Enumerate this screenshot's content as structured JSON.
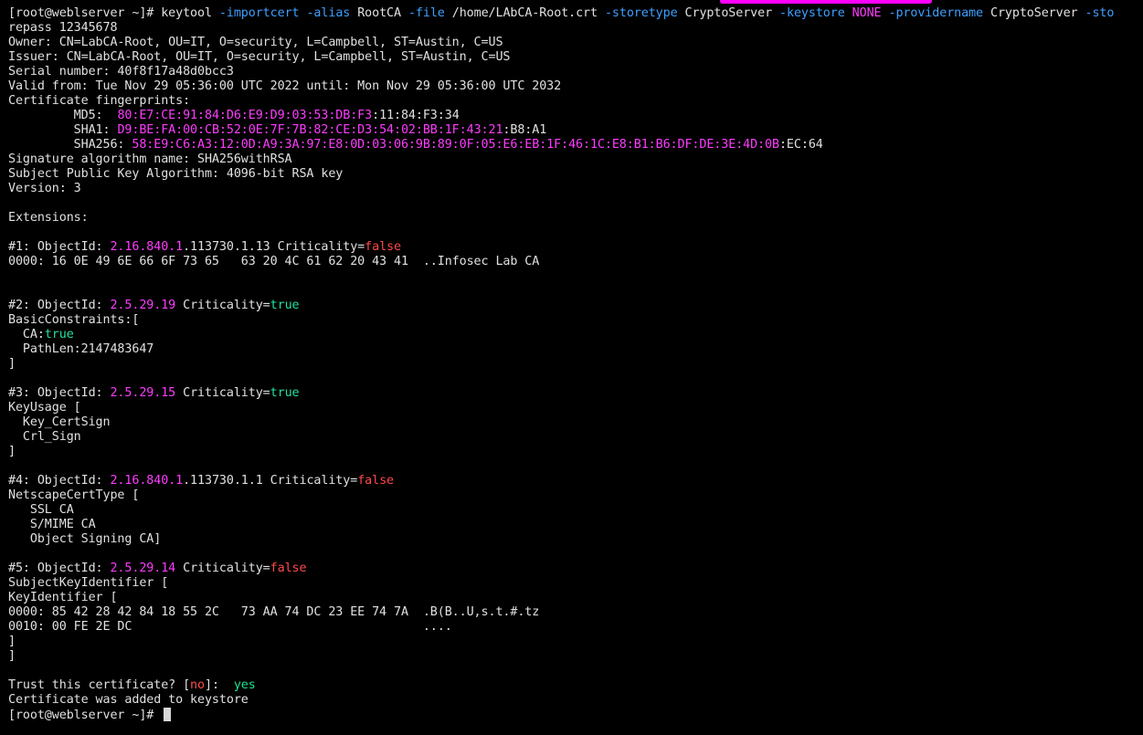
{
  "terminal": {
    "lines": [
      [
        {
          "t": "[root@weblserver ~]# keytool ",
          "c": "default"
        },
        {
          "t": "-importcert",
          "c": "option"
        },
        {
          "t": " ",
          "c": "default"
        },
        {
          "t": "-alias",
          "c": "option"
        },
        {
          "t": " RootCA ",
          "c": "default"
        },
        {
          "t": "-file",
          "c": "option"
        },
        {
          "t": " /home/LAbCA-Root.crt ",
          "c": "default"
        },
        {
          "t": "-storetype",
          "c": "option"
        },
        {
          "t": " CryptoServer ",
          "c": "default"
        },
        {
          "t": "-keystore",
          "c": "option"
        },
        {
          "t": " ",
          "c": "default"
        },
        {
          "t": "NONE",
          "c": "magenta"
        },
        {
          "t": " ",
          "c": "default"
        },
        {
          "t": "-providername",
          "c": "option"
        },
        {
          "t": " CryptoServer ",
          "c": "default"
        },
        {
          "t": "-sto",
          "c": "option"
        }
      ],
      [
        {
          "t": "repass 12345678",
          "c": "default"
        }
      ],
      [
        {
          "t": "Owner: CN=LabCA-Root, OU=IT, O=security, L=Campbell, ST=Austin, C=US",
          "c": "default"
        }
      ],
      [
        {
          "t": "Issuer: CN=LabCA-Root, OU=IT, O=security, L=Campbell, ST=Austin, C=US",
          "c": "default"
        }
      ],
      [
        {
          "t": "Serial number: 40f8f17a48d0bcc3",
          "c": "default"
        }
      ],
      [
        {
          "t": "Valid from: Tue Nov 29 05:36:00 UTC 2022 until: Mon Nov 29 05:36:00 UTC 2032",
          "c": "default"
        }
      ],
      [
        {
          "t": "Certificate fingerprints:",
          "c": "default"
        }
      ],
      [
        {
          "t": "         MD5:  ",
          "c": "default"
        },
        {
          "t": "80:E7:CE:91:84:D6:E9:D9:03:53:DB:F3",
          "c": "magenta"
        },
        {
          "t": ":11:84:F3:34",
          "c": "default"
        }
      ],
      [
        {
          "t": "         SHA1: ",
          "c": "default"
        },
        {
          "t": "D9:BE:FA:00:CB:52:0E:7F:7B:82:CE:D3:54:02:BB:1F:43:21",
          "c": "magenta"
        },
        {
          "t": ":B8:A1",
          "c": "default"
        }
      ],
      [
        {
          "t": "         SHA256: ",
          "c": "default"
        },
        {
          "t": "58:E9:C6:A3:12:0D:A9:3A:97:E8:0D:03:06:9B:89:0F:05:E6:EB:1F:46:1C:E8:B1:B6:DF:DE:3E:4D:0B",
          "c": "magenta"
        },
        {
          "t": ":EC:64",
          "c": "default"
        }
      ],
      [
        {
          "t": "Signature algorithm name: SHA256withRSA",
          "c": "default"
        }
      ],
      [
        {
          "t": "Subject Public Key Algorithm: 4096-bit RSA key",
          "c": "default"
        }
      ],
      [
        {
          "t": "Version: 3",
          "c": "default"
        }
      ],
      [],
      [
        {
          "t": "Extensions:",
          "c": "default"
        }
      ],
      [],
      [
        {
          "t": "#1: ObjectId: ",
          "c": "default"
        },
        {
          "t": "2.16.840.1",
          "c": "magenta"
        },
        {
          "t": ".113730.1.13 Criticality=",
          "c": "default"
        },
        {
          "t": "false",
          "c": "false"
        }
      ],
      [
        {
          "t": "0000: 16 0E 49 6E 66 6F 73 65   63 20 4C 61 62 20 43 41  ..Infosec Lab CA",
          "c": "default"
        }
      ],
      [],
      [],
      [
        {
          "t": "#2: ObjectId: ",
          "c": "default"
        },
        {
          "t": "2.5.29.19",
          "c": "magenta"
        },
        {
          "t": " Criticality=",
          "c": "default"
        },
        {
          "t": "true",
          "c": "true"
        }
      ],
      [
        {
          "t": "BasicConstraints:[",
          "c": "default"
        }
      ],
      [
        {
          "t": "  CA:",
          "c": "default"
        },
        {
          "t": "true",
          "c": "true"
        }
      ],
      [
        {
          "t": "  PathLen:2147483647",
          "c": "default"
        }
      ],
      [
        {
          "t": "]",
          "c": "default"
        }
      ],
      [],
      [
        {
          "t": "#3: ObjectId: ",
          "c": "default"
        },
        {
          "t": "2.5.29.15",
          "c": "magenta"
        },
        {
          "t": " Criticality=",
          "c": "default"
        },
        {
          "t": "true",
          "c": "true"
        }
      ],
      [
        {
          "t": "KeyUsage [",
          "c": "default"
        }
      ],
      [
        {
          "t": "  Key_CertSign",
          "c": "default"
        }
      ],
      [
        {
          "t": "  Crl_Sign",
          "c": "default"
        }
      ],
      [
        {
          "t": "]",
          "c": "default"
        }
      ],
      [],
      [
        {
          "t": "#4: ObjectId: ",
          "c": "default"
        },
        {
          "t": "2.16.840.1",
          "c": "magenta"
        },
        {
          "t": ".113730.1.1 Criticality=",
          "c": "default"
        },
        {
          "t": "false",
          "c": "false"
        }
      ],
      [
        {
          "t": "NetscapeCertType [",
          "c": "default"
        }
      ],
      [
        {
          "t": "   SSL CA",
          "c": "default"
        }
      ],
      [
        {
          "t": "   S/MIME CA",
          "c": "default"
        }
      ],
      [
        {
          "t": "   Object Signing CA]",
          "c": "default"
        }
      ],
      [],
      [
        {
          "t": "#5: ObjectId: ",
          "c": "default"
        },
        {
          "t": "2.5.29.14",
          "c": "magenta"
        },
        {
          "t": " Criticality=",
          "c": "default"
        },
        {
          "t": "false",
          "c": "false"
        }
      ],
      [
        {
          "t": "SubjectKeyIdentifier [",
          "c": "default"
        }
      ],
      [
        {
          "t": "KeyIdentifier [",
          "c": "default"
        }
      ],
      [
        {
          "t": "0000: 85 42 28 42 84 18 55 2C   73 AA 74 DC 23 EE 74 7A  .B(B..U,s.t.#.tz",
          "c": "default"
        }
      ],
      [
        {
          "t": "0010: 00 FE 2E DC                                        ....",
          "c": "default"
        }
      ],
      [
        {
          "t": "]",
          "c": "default"
        }
      ],
      [
        {
          "t": "]",
          "c": "default"
        }
      ],
      [],
      [
        {
          "t": "Trust this certificate? [",
          "c": "default"
        },
        {
          "t": "no",
          "c": "false"
        },
        {
          "t": "]:  ",
          "c": "default"
        },
        {
          "t": "yes",
          "c": "answer"
        }
      ],
      [
        {
          "t": "Certificate was added to keystore",
          "c": "default"
        }
      ],
      [
        {
          "t": "[root@weblserver ~]# ",
          "c": "default"
        }
      ]
    ]
  },
  "colors": {
    "background": "#000000",
    "text": "#e0e0e0",
    "option": "#3ca0ff",
    "magenta": "#ff3cff",
    "false": "#ff4a4a",
    "true": "#1fe0a0",
    "indicator": "#ff00ff"
  }
}
